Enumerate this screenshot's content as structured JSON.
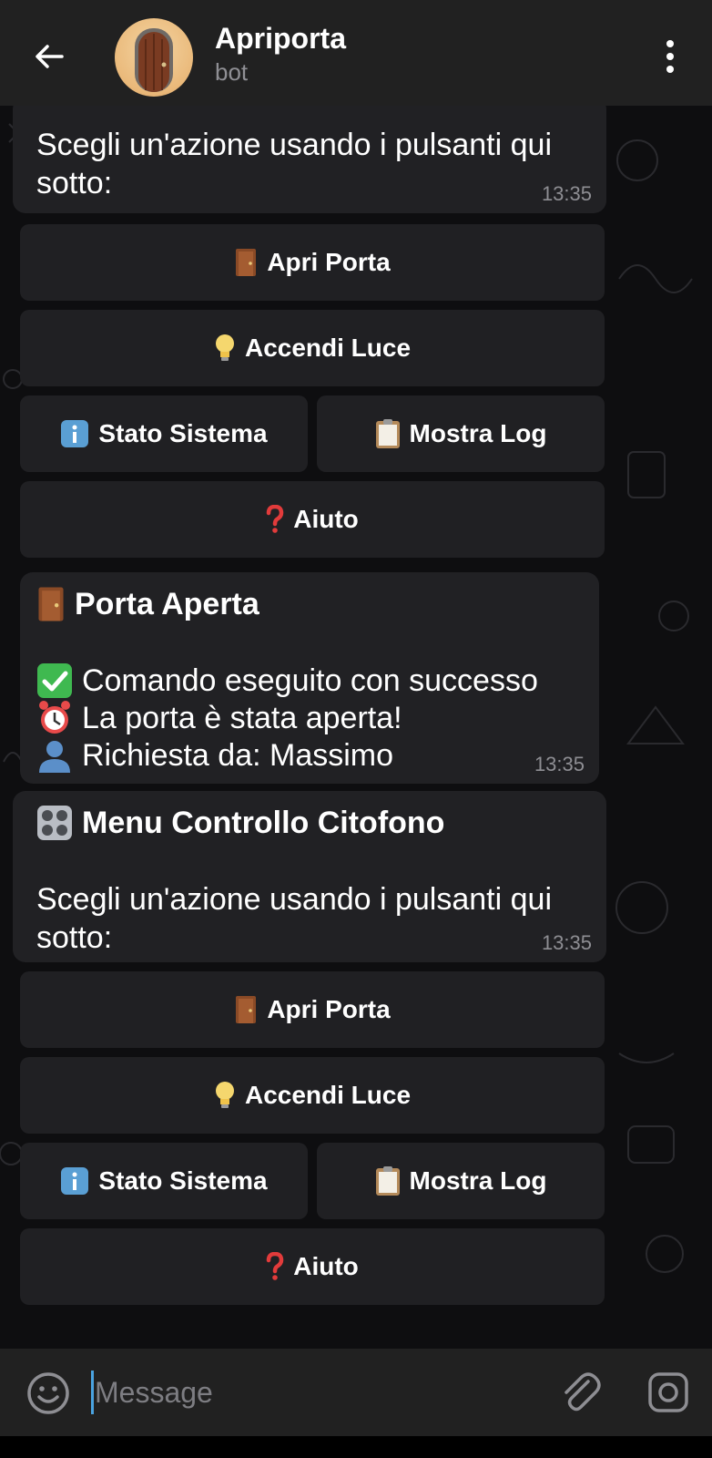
{
  "header": {
    "title": "Apriporta",
    "subtitle": "bot"
  },
  "messages": {
    "m1": {
      "text_line1": "Scegli un'azione usando i pulsanti qui",
      "text_line2": "sotto:",
      "time": "13:35"
    },
    "keyboard1": {
      "apri": "Apri Porta",
      "luce": "Accendi Luce",
      "stato": "Stato Sistema",
      "log": "Mostra Log",
      "aiuto": "Aiuto"
    },
    "m2": {
      "title": "Porta Aperta",
      "line1": "Comando eseguito con successo",
      "line2": "La porta è stata aperta!",
      "line3": "Richiesta da: Massimo",
      "time": "13:35"
    },
    "m3": {
      "title": "Menu Controllo Citofono",
      "text_line1": "Scegli un'azione usando i pulsanti qui",
      "text_line2": "sotto:",
      "time": "13:35"
    },
    "keyboard2": {
      "apri": "Apri Porta",
      "luce": "Accendi Luce",
      "stato": "Stato Sistema",
      "log": "Mostra Log",
      "aiuto": "Aiuto"
    }
  },
  "composer": {
    "placeholder": "Message"
  },
  "icons": {
    "back": "arrow-left-icon",
    "menu": "more-vertical-icon",
    "emoji": "smiley-icon",
    "attach": "paperclip-icon",
    "camera": "camera-icon",
    "door": "door-icon",
    "bulb": "light-bulb-icon",
    "info": "info-icon",
    "clipboard": "clipboard-icon",
    "question": "question-mark-icon",
    "check": "check-mark-icon",
    "alarm": "alarm-clock-icon",
    "user": "user-silhouette-icon",
    "control": "control-knobs-icon"
  },
  "colors": {
    "header_bg": "#212121",
    "bubble_bg": "#212124",
    "accent": "#4aa3e0"
  }
}
